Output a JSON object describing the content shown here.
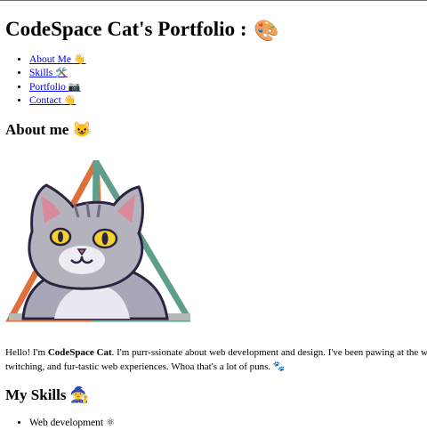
{
  "page": {
    "title": "CodeSpace Cat's Portfolio :",
    "title_emoji": "🎨"
  },
  "nav": {
    "items": [
      {
        "label": "About Me",
        "emoji": "👋"
      },
      {
        "label": "Skills",
        "emoji": "🛠️"
      },
      {
        "label": "Portfolio",
        "emoji": "📷"
      },
      {
        "label": "Contact",
        "emoji": "👋"
      }
    ]
  },
  "about": {
    "heading": "About me",
    "heading_emoji": "😺",
    "intro_before": "Hello! I'm ",
    "intro_name": "CodeSpace Cat",
    "intro_after": ". I'm purr-ssionate about web development and design. I've been pawing at the w",
    "intro_line2": "twitching, and fur-tastic web experiences. Whoa that's a lot of puns.",
    "intro_emoji": "🐾"
  },
  "skills": {
    "heading": "My Skills",
    "heading_emoji": "🧙",
    "items": [
      {
        "label": "Web development",
        "emoji": "⚛"
      }
    ]
  },
  "colors": {
    "link": "#0000ee",
    "triangle_orange": "#e0703a",
    "triangle_teal": "#5f9e8a",
    "cat_grey": "#a8a8b0",
    "cat_outline": "#2b2440"
  }
}
